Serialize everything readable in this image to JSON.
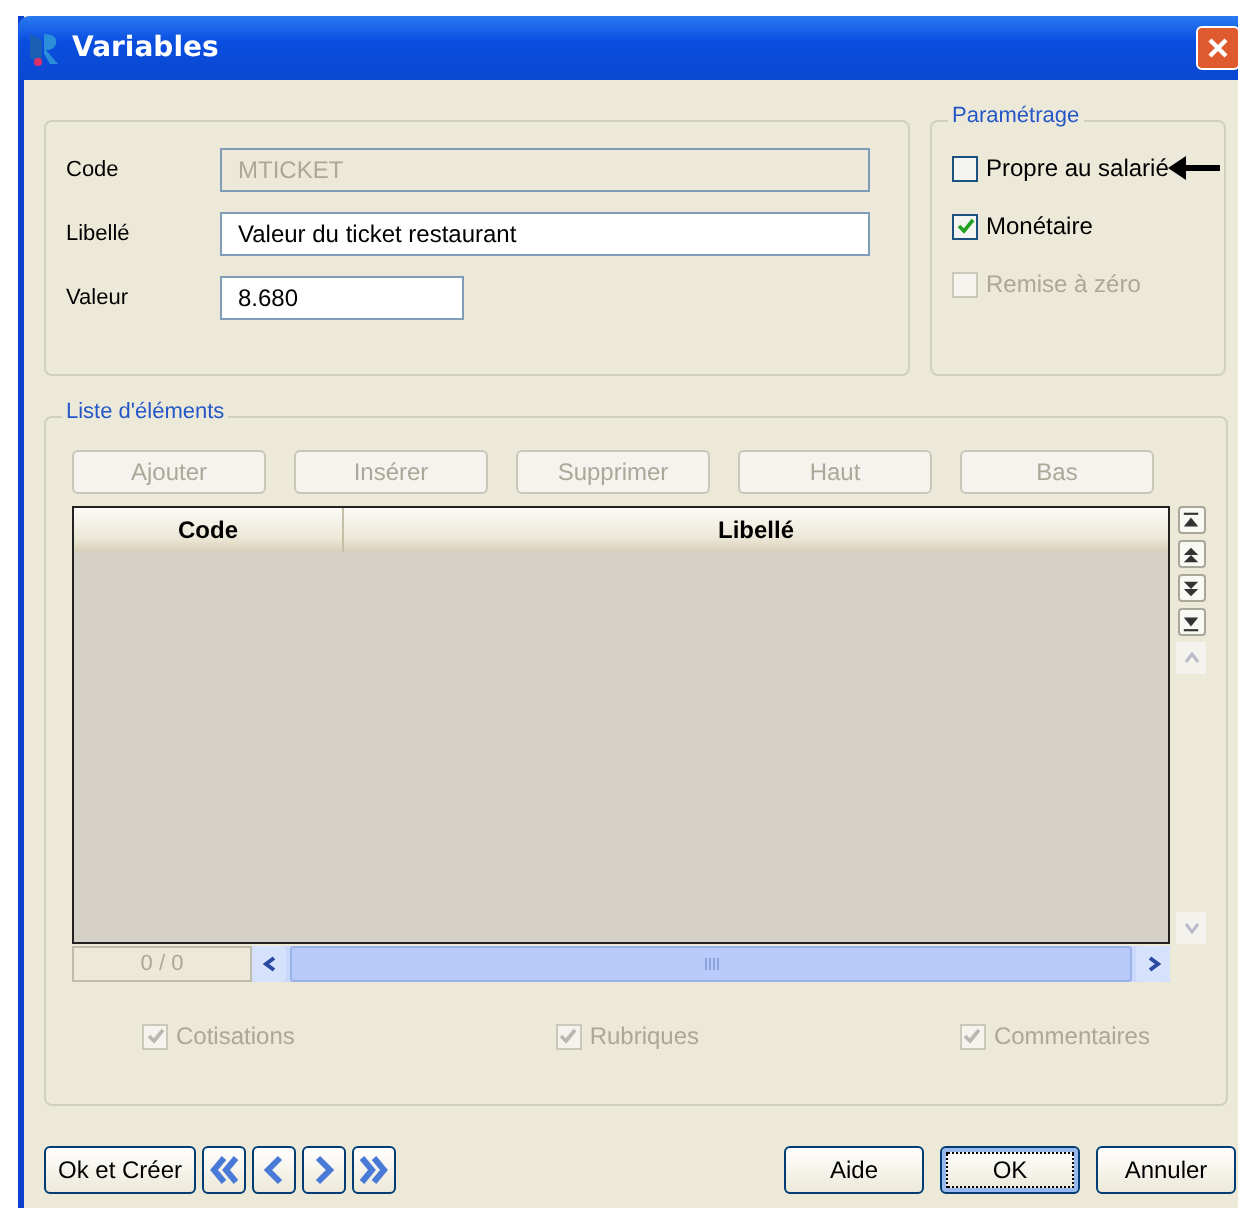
{
  "window": {
    "title": "Variables"
  },
  "fields": [
    {
      "label": "Code",
      "value": "MTICKET",
      "disabled": true
    },
    {
      "label": "Libellé",
      "value": "Valeur du ticket restaurant",
      "disabled": false
    },
    {
      "label": "Valeur",
      "value": "8.680",
      "disabled": false
    }
  ],
  "parametrage": {
    "title": "Paramétrage",
    "options": [
      {
        "label": "Propre au salarié",
        "checked": false,
        "disabled": false,
        "pointed": true
      },
      {
        "label": "Monétaire",
        "checked": true,
        "disabled": false,
        "pointed": false
      },
      {
        "label": "Remise à zéro",
        "checked": false,
        "disabled": true,
        "pointed": false
      }
    ]
  },
  "list": {
    "title": "Liste d'éléments",
    "buttons": [
      {
        "label": "Ajouter",
        "disabled": true
      },
      {
        "label": "Insérer",
        "disabled": true
      },
      {
        "label": "Supprimer",
        "disabled": true
      },
      {
        "label": "Haut",
        "disabled": true
      },
      {
        "label": "Bas",
        "disabled": true
      }
    ],
    "table": {
      "columns": [
        "Code",
        "Libellé"
      ]
    },
    "counter": "0 / 0",
    "filters": [
      {
        "label": "Cotisations",
        "checked": true,
        "disabled": true
      },
      {
        "label": "Rubriques",
        "checked": true,
        "disabled": true
      },
      {
        "label": "Commentaires",
        "checked": true,
        "disabled": true
      }
    ]
  },
  "footer": {
    "left_button": "Ok et Créer",
    "buttons": [
      {
        "label": "Aide",
        "default": false
      },
      {
        "label": "OK",
        "default": true
      },
      {
        "label": "Annuler",
        "default": false
      }
    ]
  }
}
